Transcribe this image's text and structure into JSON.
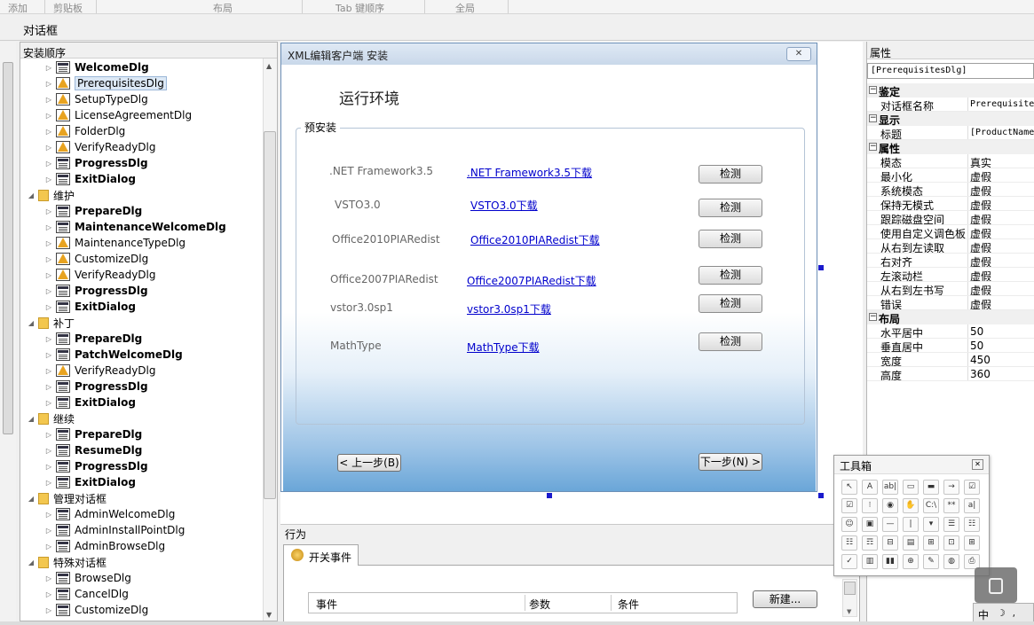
{
  "ribbon": {
    "groups": [
      "添加",
      "剪贴板",
      "布局",
      "Tab 键顺序",
      "全局"
    ]
  },
  "document": {
    "title": "对话框"
  },
  "tree": {
    "header": "安装顺序",
    "nodes": [
      {
        "label": "WelcomeDlg",
        "level": 1,
        "icon": "dialog-icon",
        "bold": true
      },
      {
        "label": "PrerequisitesDlg",
        "level": 1,
        "icon": "warning-dialog-icon",
        "bold": false,
        "selected": true
      },
      {
        "label": "SetupTypeDlg",
        "level": 1,
        "icon": "warning-dialog-icon",
        "bold": false
      },
      {
        "label": "LicenseAgreementDlg",
        "level": 1,
        "icon": "warning-dialog-icon",
        "bold": false
      },
      {
        "label": "FolderDlg",
        "level": 1,
        "icon": "warning-dialog-icon",
        "bold": false
      },
      {
        "label": "VerifyReadyDlg",
        "level": 1,
        "icon": "warning-dialog-icon",
        "bold": false
      },
      {
        "label": "ProgressDlg",
        "level": 1,
        "icon": "dialog-icon",
        "bold": true
      },
      {
        "label": "ExitDialog",
        "level": 1,
        "icon": "dialog-icon",
        "bold": true
      },
      {
        "label": "维护",
        "level": 0,
        "icon": "folder-icon",
        "bold": false
      },
      {
        "label": "PrepareDlg",
        "level": 1,
        "icon": "dialog-icon",
        "bold": true
      },
      {
        "label": "MaintenanceWelcomeDlg",
        "level": 1,
        "icon": "dialog-icon",
        "bold": true
      },
      {
        "label": "MaintenanceTypeDlg",
        "level": 1,
        "icon": "warning-dialog-icon",
        "bold": false
      },
      {
        "label": "CustomizeDlg",
        "level": 1,
        "icon": "warning-dialog-icon",
        "bold": false
      },
      {
        "label": "VerifyReadyDlg",
        "level": 1,
        "icon": "warning-dialog-icon",
        "bold": false
      },
      {
        "label": "ProgressDlg",
        "level": 1,
        "icon": "dialog-icon",
        "bold": true
      },
      {
        "label": "ExitDialog",
        "level": 1,
        "icon": "dialog-icon",
        "bold": true
      },
      {
        "label": "补丁",
        "level": 0,
        "icon": "folder-icon",
        "bold": false
      },
      {
        "label": "PrepareDlg",
        "level": 1,
        "icon": "dialog-icon",
        "bold": true
      },
      {
        "label": "PatchWelcomeDlg",
        "level": 1,
        "icon": "dialog-icon",
        "bold": true
      },
      {
        "label": "VerifyReadyDlg",
        "level": 1,
        "icon": "warning-dialog-icon",
        "bold": false
      },
      {
        "label": "ProgressDlg",
        "level": 1,
        "icon": "dialog-icon",
        "bold": true
      },
      {
        "label": "ExitDialog",
        "level": 1,
        "icon": "dialog-icon",
        "bold": true
      },
      {
        "label": "继续",
        "level": 0,
        "icon": "folder-icon",
        "bold": false
      },
      {
        "label": "PrepareDlg",
        "level": 1,
        "icon": "dialog-icon",
        "bold": true
      },
      {
        "label": "ResumeDlg",
        "level": 1,
        "icon": "dialog-icon",
        "bold": true
      },
      {
        "label": "ProgressDlg",
        "level": 1,
        "icon": "dialog-icon",
        "bold": true
      },
      {
        "label": "ExitDialog",
        "level": 1,
        "icon": "dialog-icon",
        "bold": true
      },
      {
        "label": "管理对话框",
        "level": 0,
        "icon": "folder-icon",
        "bold": false
      },
      {
        "label": "AdminWelcomeDlg",
        "level": 1,
        "icon": "dialog-icon",
        "bold": false
      },
      {
        "label": "AdminInstallPointDlg",
        "level": 1,
        "icon": "dialog-icon",
        "bold": false
      },
      {
        "label": "AdminBrowseDlg",
        "level": 1,
        "icon": "dialog-icon",
        "bold": false
      },
      {
        "label": "特殊对话框",
        "level": 0,
        "icon": "folder-icon",
        "bold": false
      },
      {
        "label": "BrowseDlg",
        "level": 1,
        "icon": "dialog-icon",
        "bold": false
      },
      {
        "label": "CancelDlg",
        "level": 1,
        "icon": "dialog-icon",
        "bold": false
      },
      {
        "label": "CustomizeDlg",
        "level": 1,
        "icon": "dialog-icon",
        "bold": false
      }
    ]
  },
  "dialog": {
    "title": "XML编辑客户端 安装",
    "close_label": "✕",
    "heading": "运行环境",
    "group_label": "预安装",
    "rows": [
      {
        "name": ".NET Framework3.5",
        "link": ".NET Framework3.5下载",
        "button": "检测"
      },
      {
        "name": "VSTO3.0",
        "link": "VSTO3.0下载",
        "button": "检测"
      },
      {
        "name": "Office2010PIARedist",
        "link": "Office2010PIARedist下载",
        "button": "检测"
      },
      {
        "name": "Office2007PIARedist",
        "link": "Office2007PIARedist下载",
        "button": "检测"
      },
      {
        "name": "vstor3.0sp1",
        "link": "vstor3.0sp1下载",
        "button": "检测"
      },
      {
        "name": "MathType",
        "link": "MathType下载",
        "button": "检测"
      }
    ],
    "back_button": "< 上一步(B)",
    "next_button": "下一步(N) >"
  },
  "behavior": {
    "title": "行为",
    "tab_label": "开关事件",
    "columns": [
      "事件",
      "参数",
      "条件"
    ],
    "new_button": "新建..."
  },
  "properties": {
    "header": "属性",
    "selected_object": "[PrerequisitesDlg]",
    "categories": [
      {
        "name": "鉴定",
        "items": [
          {
            "name": "对话框名称",
            "value": "Prerequisite",
            "mono": true
          }
        ]
      },
      {
        "name": "显示",
        "items": [
          {
            "name": "标题",
            "value": "[ProductName",
            "mono": true
          }
        ]
      },
      {
        "name": "属性",
        "items": [
          {
            "name": "模态",
            "value": "真实"
          },
          {
            "name": "最小化",
            "value": "虚假"
          },
          {
            "name": "系统模态",
            "value": "虚假"
          },
          {
            "name": "保持无模式",
            "value": "虚假"
          },
          {
            "name": "跟踪磁盘空间",
            "value": "虚假"
          },
          {
            "name": "使用自定义调色板",
            "value": "虚假"
          },
          {
            "name": "从右到左读取",
            "value": "虚假"
          },
          {
            "name": "右对齐",
            "value": "虚假"
          },
          {
            "name": "左滚动栏",
            "value": "虚假"
          },
          {
            "name": "从右到左书写",
            "value": "虚假"
          },
          {
            "name": "错误",
            "value": "虚假"
          }
        ]
      },
      {
        "name": "布局",
        "items": [
          {
            "name": "水平居中",
            "value": "50"
          },
          {
            "name": "垂直居中",
            "value": "50"
          },
          {
            "name": "宽度",
            "value": "450"
          },
          {
            "name": "高度",
            "value": "360"
          }
        ]
      }
    ]
  },
  "toolbox": {
    "title": "工具箱",
    "close_label": "✕",
    "tools": [
      "pointer-tool-icon",
      "text-tool-icon",
      "edit-field-tool-icon",
      "push-button-tool-icon",
      "orange-button-tool-icon",
      "arrow-button-tool-icon",
      "checkbox-tool-icon",
      "checkbox-blue-tool-icon",
      "radio-group-tool-icon",
      "radio-button-tool-icon",
      "hand-tool-icon",
      "path-edit-tool-icon",
      "masked-edit-tool-icon",
      "scrollable-text-tool-icon",
      "smiley-tool-icon",
      "bitmap-tool-icon",
      "line-tool-icon",
      "vertical-line-tool-icon",
      "combo-box-tool-icon",
      "list-box-tool-icon",
      "directory-list-tool-icon",
      "list-view-tool-icon",
      "selection-tree-tool-icon",
      "volume-list-tool-icon",
      "volume-combo-tool-icon",
      "progress-tool-icon",
      "billboard-tool-icon",
      "tree-tool-icon",
      "checklist-tool-icon",
      "billboard-bar-tool-icon",
      "progress-bar-tool-icon",
      "registry-tool-icon",
      "link-tool-icon",
      "disk-tool-icon",
      "printer-tool-icon"
    ],
    "glyphs": [
      "↖",
      "A",
      "ab|",
      "▭",
      "▬",
      "→",
      "☑",
      "☑",
      "⁝",
      "◉",
      "✋",
      "C:\\",
      "**",
      "a|",
      "☺",
      "▣",
      "—",
      "|",
      "▾",
      "☰",
      "☷",
      "☷",
      "☶",
      "⊟",
      "▤",
      "⊞",
      "⊡",
      "⊞",
      "✓",
      "▥",
      "▮▮",
      "⊕",
      "✎",
      "◍",
      "⎙"
    ]
  },
  "ime": {
    "label": "中"
  }
}
